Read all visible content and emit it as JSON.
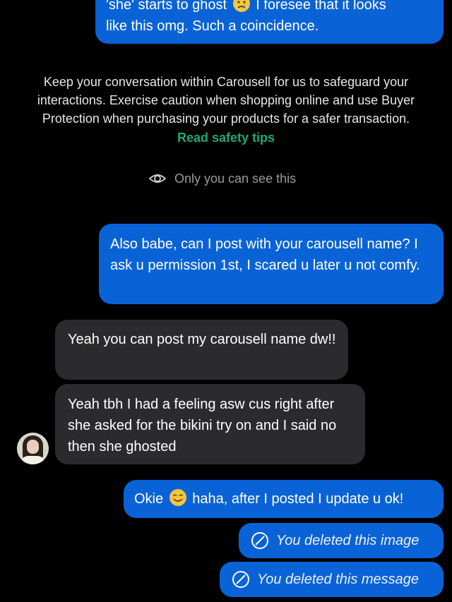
{
  "messages": {
    "top_partial": {
      "line1_pre": "'she' starts to ghost",
      "line1_post": "I foresee that it looks",
      "line2": "like this omg. Such a coincidence."
    },
    "safety": {
      "text": "Keep your conversation within Carousell for us to safeguard your interactions. Exercise caution when shopping online and use Buyer Protection when purchasing your products for a safer transaction.",
      "link": "Read safety tips",
      "visibility": "Only you can see this"
    },
    "out_1": "Also babe, can I post with your carousell name? I ask u permission 1st, I scared u later u not comfy.",
    "in_1": "Yeah you can post my carousell name dw!!",
    "in_2": "Yeah tbh I had a feeling asw cus right after she asked for the bikini try on and I said no then she ghosted",
    "out_2": {
      "pre": "Okie",
      "post": "haha, after I posted I update u ok!"
    },
    "deleted_image": "You deleted this image",
    "deleted_message": "You deleted this message"
  },
  "colors": {
    "background": "#000000",
    "outgoing_bubble": "#0a63d6",
    "incoming_bubble": "#2b2b2d",
    "link_green": "#22a67a",
    "muted_text": "#9a9a9a"
  },
  "icons": {
    "eye": "eye-icon",
    "ban": "ban-icon",
    "emoji_smile": "smiling-face-emoji",
    "emoji_sad": "crying-face-emoji"
  }
}
